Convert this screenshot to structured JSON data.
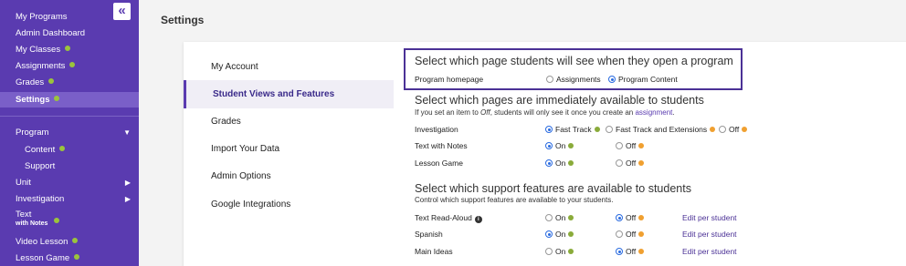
{
  "sidebar": {
    "items": [
      {
        "label": "My Programs"
      },
      {
        "label": "Admin Dashboard"
      },
      {
        "label": "My Classes"
      },
      {
        "label": "Assignments"
      },
      {
        "label": "Grades"
      },
      {
        "label": "Settings"
      },
      {
        "label": "Program"
      },
      {
        "label": "Content"
      },
      {
        "label": "Support"
      },
      {
        "label": "Unit"
      },
      {
        "label": "Investigation"
      },
      {
        "label": "Text",
        "sub": "with Notes"
      },
      {
        "label": "Video Lesson"
      },
      {
        "label": "Lesson Game"
      }
    ]
  },
  "page": {
    "title": "Settings"
  },
  "menu": {
    "items": [
      {
        "label": "My Account"
      },
      {
        "label": "Student Views and Features"
      },
      {
        "label": "Grades"
      },
      {
        "label": "Import Your Data"
      },
      {
        "label": "Admin Options"
      },
      {
        "label": "Google Integrations"
      }
    ]
  },
  "homepage": {
    "title": "Select which page students will see when they open a program",
    "label": "Program homepage",
    "options": [
      "Assignments",
      "Program Content"
    ],
    "selected": "Program Content"
  },
  "availability": {
    "title": "Select which pages are immediately available to students",
    "subtitle_before": "If you set an item to ",
    "subtitle_off": "Off",
    "subtitle_middle": ", students will only see it once you create an ",
    "subtitle_link": "assignment",
    "subtitle_end": ".",
    "rows": [
      {
        "label": "Investigation",
        "opt1": "Fast Track",
        "opt2": "Fast Track and Extensions",
        "opt3": "Off"
      },
      {
        "label": "Text with Notes",
        "opt1": "On",
        "opt2": "Off"
      },
      {
        "label": "Lesson Game",
        "opt1": "On",
        "opt2": "Off"
      }
    ]
  },
  "support": {
    "title": "Select which support features are available to students",
    "subtitle": "Control which support features are available to your students.",
    "edit_label": "Edit per student",
    "rows": [
      {
        "label": "Text Read-Aloud",
        "on": "On",
        "off": "Off",
        "selected": "Off"
      },
      {
        "label": "Spanish",
        "on": "On",
        "off": "Off",
        "selected": "On"
      },
      {
        "label": "Main Ideas",
        "on": "On",
        "off": "Off",
        "selected": "Off"
      }
    ]
  },
  "colors": {
    "sidebar": "#5a3bb0",
    "accent": "#4b3196",
    "green": "#8aab3a",
    "orange": "#f0a030"
  }
}
